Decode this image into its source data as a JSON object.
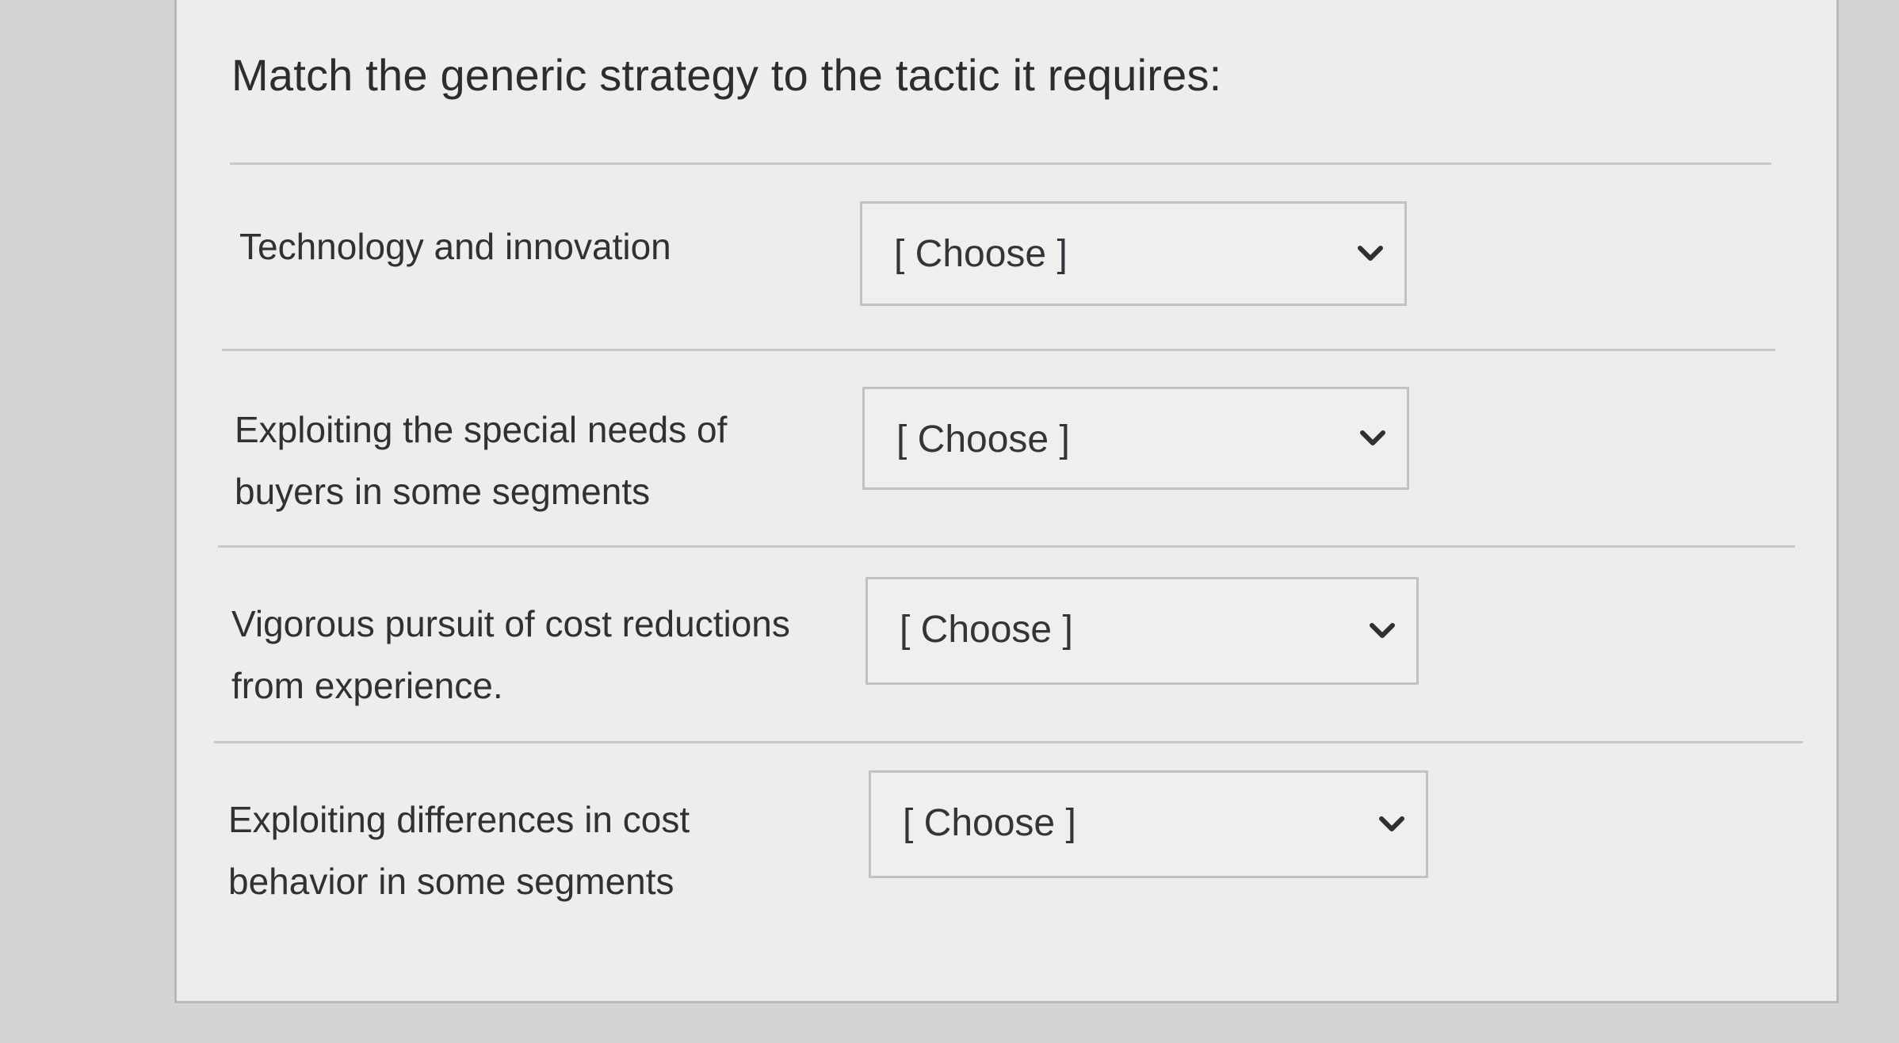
{
  "question": {
    "prompt": "Match the generic strategy to the tactic it requires:"
  },
  "rows": [
    {
      "label": "Technology and innovation",
      "select_value": "[ Choose ]",
      "chevron_icon": "chevron-down-icon"
    },
    {
      "label": "Exploiting the special needs of buyers in some segments",
      "select_value": "[ Choose ]",
      "chevron_icon": "chevron-down-icon"
    },
    {
      "label": "Vigorous pursuit of cost reductions from experience.",
      "select_value": "[ Choose ]",
      "chevron_icon": "chevron-down-icon"
    },
    {
      "label": "Exploiting differences in cost behavior in some segments",
      "select_value": "[ Choose ]",
      "chevron_icon": "chevron-down-icon"
    }
  ],
  "colors": {
    "page_background": "#d4d4d2",
    "card_background": "#ededeb",
    "text": "#2b2d30",
    "border": "#c2c3c1"
  }
}
